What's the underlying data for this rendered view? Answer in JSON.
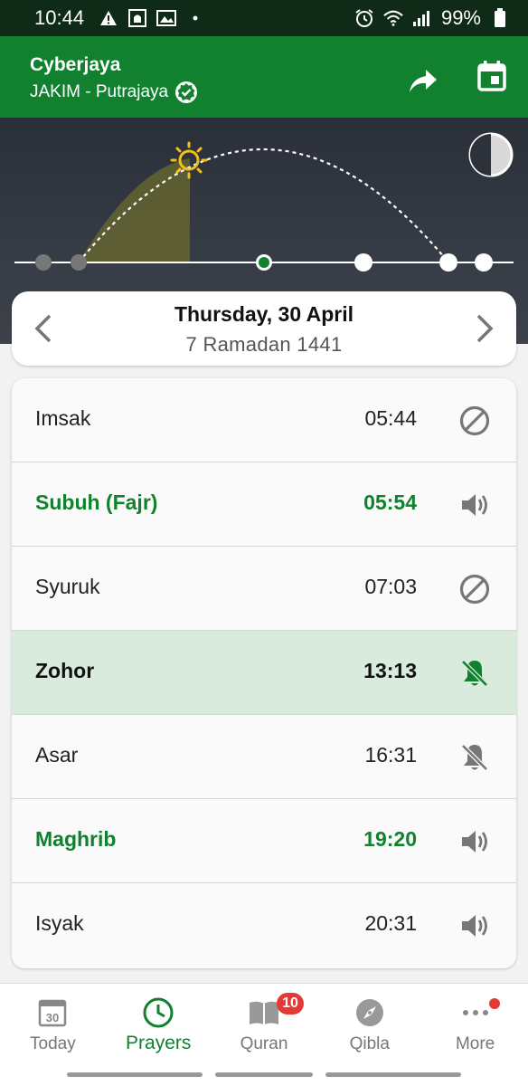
{
  "status_bar": {
    "time": "10:44",
    "battery": "99%"
  },
  "header": {
    "location": "Cyberjaya",
    "zone": "JAKIM - Putrajaya",
    "icons": [
      "verified-icon",
      "share-icon",
      "calendar-icon"
    ]
  },
  "sky_timeline": {
    "sun_progress": 0.41,
    "icons": [
      "sun-icon",
      "moon-phase-icon"
    ]
  },
  "date_card": {
    "gregorian": "Thursday, 30 April",
    "hijri": "7 Ramadan 1441"
  },
  "prayers": [
    {
      "name": "Imsak",
      "time": "05:44",
      "alert_icon": "disabled-icon",
      "highlight": "none"
    },
    {
      "name": "Subuh (Fajr)",
      "time": "05:54",
      "alert_icon": "volume-icon",
      "highlight": "green"
    },
    {
      "name": "Syuruk",
      "time": "07:03",
      "alert_icon": "disabled-icon",
      "highlight": "none"
    },
    {
      "name": "Zohor",
      "time": "13:13",
      "alert_icon": "bell-off-icon",
      "highlight": "current"
    },
    {
      "name": "Asar",
      "time": "16:31",
      "alert_icon": "bell-off-icon",
      "highlight": "none"
    },
    {
      "name": "Maghrib",
      "time": "19:20",
      "alert_icon": "volume-icon",
      "highlight": "green"
    },
    {
      "name": "Isyak",
      "time": "20:31",
      "alert_icon": "volume-icon",
      "highlight": "none"
    }
  ],
  "bottom_nav": {
    "items": [
      {
        "label": "Today",
        "icon": "calendar-day-icon",
        "icon_text": "30"
      },
      {
        "label": "Prayers",
        "icon": "clock-icon",
        "active": true
      },
      {
        "label": "Quran",
        "icon": "book-icon",
        "badge": "10"
      },
      {
        "label": "Qibla",
        "icon": "compass-icon"
      },
      {
        "label": "More",
        "icon": "more-dots-icon"
      }
    ]
  },
  "colors": {
    "primary": "#11802f",
    "status_bar": "#0f2a16",
    "current_row": "#d8ebdd",
    "badge": "#e53935",
    "sun": "#f2c21b"
  }
}
